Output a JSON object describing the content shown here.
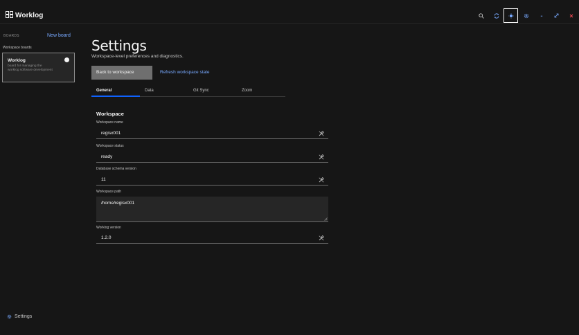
{
  "header": {
    "app_title": "Worklog",
    "buttons": [
      {
        "icon": "search-icon"
      },
      {
        "icon": "sync-icon"
      },
      {
        "icon": "theme-icon"
      },
      {
        "icon": "gear-icon"
      },
      {
        "icon": "minimize-icon"
      },
      {
        "icon": "maximize-icon"
      },
      {
        "icon": "close-icon"
      }
    ]
  },
  "sidebar": {
    "boards_label": "BOARDS",
    "new_board_label": "New board",
    "workspace_boards_label": "Workspace boards",
    "board": {
      "title": "Worklog",
      "description": "board for managing the worklog software development"
    },
    "settings_label": "Settings"
  },
  "main": {
    "title": "Settings",
    "subtitle": "Workspace-level preferences and diagnostics.",
    "back_button": "Back to workspace",
    "refresh_link": "Refresh workspace state",
    "tabs": [
      {
        "label": "General",
        "selected": true
      },
      {
        "label": "Data",
        "selected": false
      },
      {
        "label": "Git Sync",
        "selected": false
      },
      {
        "label": "Zoom",
        "selected": false
      }
    ],
    "section_title": "Workspace",
    "fields": {
      "workspace_name": {
        "label": "Workspace name",
        "value": "regisx001"
      },
      "workspace_status": {
        "label": "Workspace status",
        "value": "ready"
      },
      "db_schema_version": {
        "label": "Database schema version",
        "value": "11"
      },
      "workspace_path": {
        "label": "Workspace path",
        "value": "/home/regisx001"
      },
      "worklog_version": {
        "label": "Worklog version",
        "value": "1.2.0"
      }
    }
  },
  "colors": {
    "background": "#161616",
    "accent_blue": "#78a9ff",
    "tab_indicator": "#0f62fe",
    "close_red": "#fa4d56",
    "primary_button": "#6f6f6f"
  }
}
